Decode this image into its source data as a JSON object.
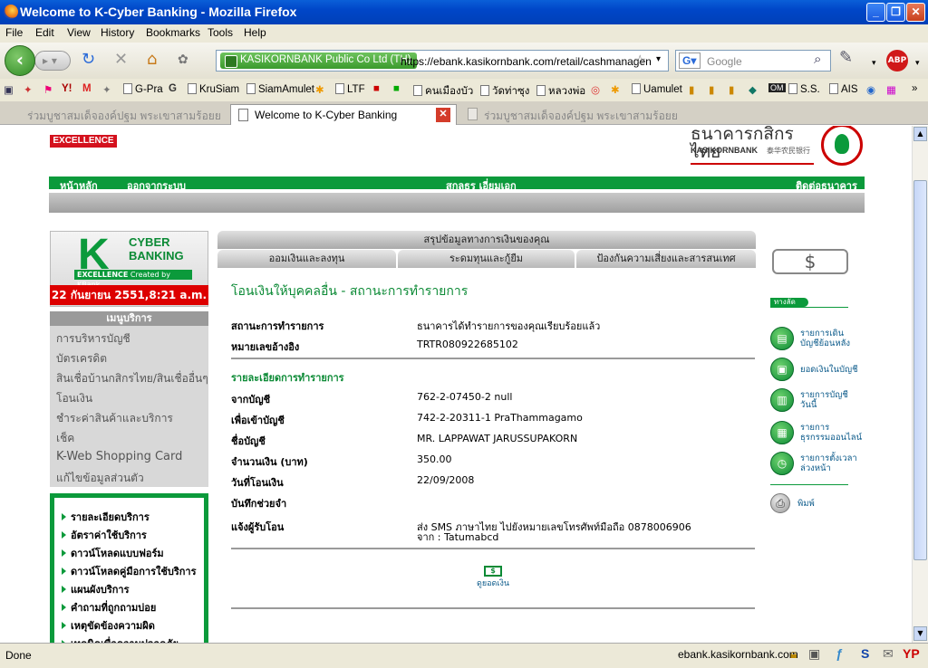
{
  "window": {
    "title": "Welcome to K-Cyber Banking - Mozilla Firefox"
  },
  "menu": [
    "File",
    "Edit",
    "View",
    "History",
    "Bookmarks",
    "Tools",
    "Help"
  ],
  "url": {
    "identity": "KASIKORNBANK Public Co Ltd (TH)",
    "address": "https://ebank.kasikornbank.com/retail/cashmanagen"
  },
  "search": {
    "placeholder": "Google"
  },
  "bookmarks": [
    "G-Pra",
    "KruSiam",
    "SiamAmulet",
    "LTF",
    "คนเมืองบัว",
    "วัดท่าซุง",
    "หลวงพ่อ",
    "Uamulet",
    "S.S.",
    "AIS"
  ],
  "tabs": [
    {
      "label": "ร่วมบูชาสมเด็จองค์ปฐม พระเขาสามร้อยย",
      "active": false
    },
    {
      "label": "Welcome to K-Cyber Banking",
      "active": true
    },
    {
      "label": "ร่วมบูชาสมเด็จองค์ปฐม พระเขาสามร้อยย",
      "active": false
    }
  ],
  "status": {
    "left": "Done",
    "domain": "ebank.kasikornbank.com"
  },
  "page": {
    "excellence": "EXCELLENCE",
    "bank_thai": "ธนาคารกสิกรไทย",
    "bank_en": "KASIKORNBANK",
    "bank_cn": "泰华农民银行",
    "topnav": {
      "home": "หน้าหลัก",
      "logout": "ออกจากระบบ",
      "user": "สกลธร เอี่ยมเอก",
      "contact": "ติดต่อธนาคาร"
    },
    "card": {
      "cyber": "CYBER",
      "banking": "BANKING",
      "excellence": "EXCELLENCE",
      "created": "Created by KBank",
      "date": "22 กันยายน 2551,8:21 a.m."
    },
    "service_menu": {
      "title": "เมนูบริการ",
      "items": [
        "การบริหารบัญชี",
        "บัตรเครดิต",
        "สินเชื่อบ้านกสิกรไทย/สินเชื่ออื่นๆ",
        "โอนเงิน",
        "ชำระค่าสินค้าและบริการ",
        "เช็ค",
        "K-Web Shopping Card",
        "แก้ไขข้อมูลส่วนตัว"
      ]
    },
    "links": [
      "รายละเอียดบริการ",
      "อัตราค่าใช้บริการ",
      "ดาวน์โหลดแบบฟอร์ม",
      "ดาวน์โหลดคู่มือการใช้บริการ",
      "แผนผังบริการ",
      "คำถามที่ถูกถามบ่อย",
      "เหตุขัดข้องความผิด",
      "เทคนิคเพื่อความปลอดภัย"
    ],
    "top_tabs": {
      "summary": "สรุปข้อมูลทางการเงินของคุณ",
      "invest": "ออมเงินและลงทุน",
      "funding": "ระดมทุนและกู้ยืม",
      "protect": "ป้องกันความเสี่ยงและสารสนเทศ"
    },
    "title": "โอนเงินให้บุคคลอื่น - สถานะการทำรายการ",
    "status_rows": [
      {
        "label": "สถานะการทำรายการ",
        "value": "ธนาคารได้ทำรายการของคุณเรียบร้อยแล้ว"
      },
      {
        "label": "หมายเลขอ้างอิง",
        "value": "TRTR080922685102"
      }
    ],
    "detail_title": "รายละเอียดการทำรายการ",
    "detail_rows": [
      {
        "label": "จากบัญชี",
        "value": "762-2-07450-2 null"
      },
      {
        "label": "เพื่อเข้าบัญชี",
        "value": "742-2-20311-1 PraThammagamo"
      },
      {
        "label": "ชื่อบัญชี",
        "value": "MR. LAPPAWAT JARUSSUPAKORN"
      },
      {
        "label": "จำนวนเงิน (บาท)",
        "value": "350.00"
      },
      {
        "label": "วันที่โอนเงิน",
        "value": "22/09/2008"
      },
      {
        "label": "บันทึกช่วยจำ",
        "value": ""
      }
    ],
    "notify": {
      "label": "แจ้งผู้รับโอน",
      "line1": "ส่ง SMS ภาษาไทย ไปยังหมายเลขโทรศัพท์มือถือ 0878006906",
      "line2": "จาก : Tatumabcd"
    },
    "view_balance": "ดูยอดเงิน",
    "shortcut_title": "ทางลัด",
    "shortcuts": [
      {
        "line1": "รายการเดิน",
        "line2": "บัญชีย้อนหลัง"
      },
      {
        "line1": "ยอดเงินในบัญชี",
        "line2": ""
      },
      {
        "line1": "รายการบัญชี",
        "line2": "วันนี้"
      },
      {
        "line1": "รายการ",
        "line2": "ธุรกรรมออนไลน์"
      },
      {
        "line1": "รายการตั้งเวลา",
        "line2": "ล่วงหน้า"
      }
    ],
    "print": "พิมพ์"
  }
}
